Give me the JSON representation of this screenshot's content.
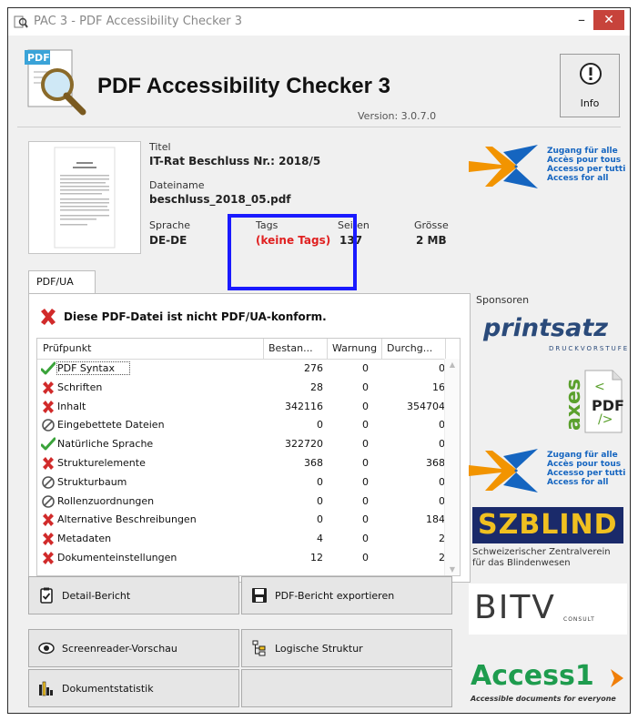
{
  "window": {
    "title": "PAC 3 - PDF Accessibility Checker 3",
    "minimize": "–",
    "close": "✕"
  },
  "header": {
    "app_name": "PDF Accessibility Checker 3",
    "version": "Version: 3.0.7.0",
    "info_label": "Info",
    "logo_badge": "PDF"
  },
  "document": {
    "title_label": "Titel",
    "title_value": "IT-Rat Beschluss Nr.: 2018/5",
    "filename_label": "Dateiname",
    "filename_value": "beschluss_2018_05.pdf",
    "language_label": "Sprache",
    "language_value": "DE-DE",
    "tags_label": "Tags",
    "tags_value": "(keine Tags)",
    "pages_label": "Seiten",
    "pages_value": "137",
    "size_label": "Grösse",
    "size_value": "2 MB"
  },
  "tab": {
    "label": "PDF/UA"
  },
  "status": {
    "message": "Diese PDF-Datei ist nicht PDF/UA-konform."
  },
  "table": {
    "columns": [
      "Prüfpunkt",
      "Bestan...",
      "Warnung",
      "Durchg..."
    ],
    "rows": [
      {
        "status": "pass",
        "name": "PDF Syntax",
        "passed": "276",
        "warnings": "0",
        "failed": "0"
      },
      {
        "status": "fail",
        "name": "Schriften",
        "passed": "28",
        "warnings": "0",
        "failed": "16"
      },
      {
        "status": "fail",
        "name": "Inhalt",
        "passed": "342116",
        "warnings": "0",
        "failed": "354704"
      },
      {
        "status": "skip",
        "name": "Eingebettete Dateien",
        "passed": "0",
        "warnings": "0",
        "failed": "0"
      },
      {
        "status": "pass",
        "name": "Natürliche Sprache",
        "passed": "322720",
        "warnings": "0",
        "failed": "0"
      },
      {
        "status": "fail",
        "name": "Strukturelemente",
        "passed": "368",
        "warnings": "0",
        "failed": "368"
      },
      {
        "status": "skip",
        "name": "Strukturbaum",
        "passed": "0",
        "warnings": "0",
        "failed": "0"
      },
      {
        "status": "skip",
        "name": "Rollenzuordnungen",
        "passed": "0",
        "warnings": "0",
        "failed": "0"
      },
      {
        "status": "fail",
        "name": "Alternative Beschreibungen",
        "passed": "0",
        "warnings": "0",
        "failed": "184"
      },
      {
        "status": "fail",
        "name": "Metadaten",
        "passed": "4",
        "warnings": "0",
        "failed": "2"
      },
      {
        "status": "fail",
        "name": "Dokumenteinstellungen",
        "passed": "12",
        "warnings": "0",
        "failed": "2"
      }
    ]
  },
  "buttons": {
    "detail_report": "Detail-Bericht",
    "export_report": "PDF-Bericht exportieren",
    "screenreader_preview": "Screenreader-Vorschau",
    "logical_structure": "Logische Struktur",
    "document_statistics": "Dokumentstatistik"
  },
  "sponsors": {
    "label": "Sponsoren",
    "zugang_lines": [
      "Zugang für alle",
      "Accès pour tous",
      "Accesso per tutti",
      "Access for all"
    ],
    "printsatz": "printsatz",
    "printsatz_sub": "DRUCKVORSTUFE",
    "axes": "axes",
    "axes_pdf": "PDF",
    "szb": "SZBLIND",
    "szb_sub1": "Schweizerischer Zentralverein",
    "szb_sub2": "für das Blindenwesen",
    "bitv": "BITV",
    "bitv_sub": "CONSULT",
    "access1": "Access1",
    "access1_sub": "Accessible documents for everyone"
  },
  "colors": {
    "fail_red": "#d12a2a",
    "pass_green": "#3aa33a",
    "highlight_blue": "#1a1aff",
    "tags_red": "#e02020",
    "access_green": "#1e9c4e",
    "access_orange": "#f07f0a",
    "zugang_orange": "#f29400",
    "zugang_blue": "#1565c0"
  },
  "icons": {
    "pass": "check-icon",
    "fail": "cross-icon",
    "skip": "not-applicable-icon"
  }
}
